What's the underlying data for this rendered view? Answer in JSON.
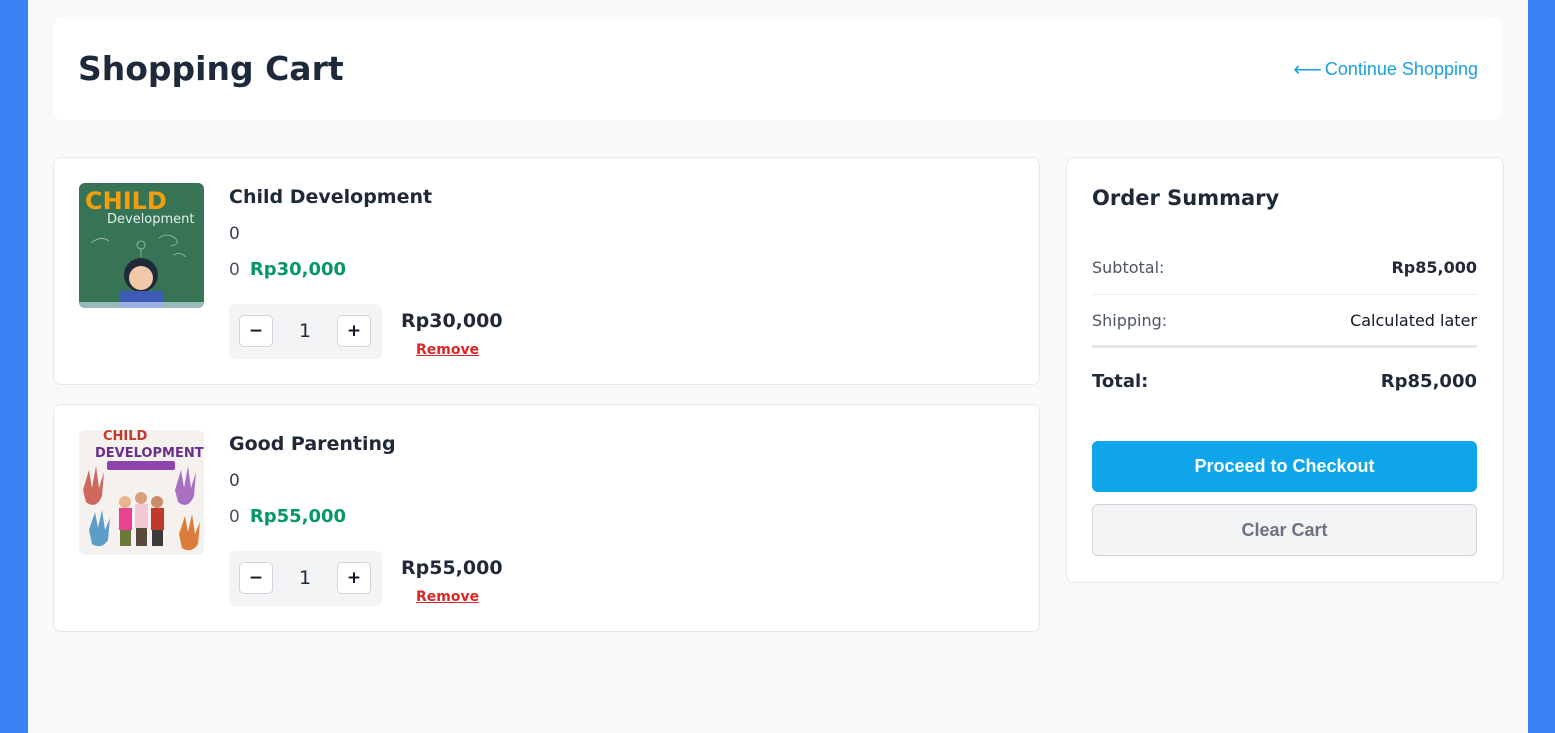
{
  "header": {
    "title": "Shopping Cart",
    "continue_arrow": "⟵",
    "continue_label": "Continue Shopping"
  },
  "cart": {
    "items": [
      {
        "title": "Child Development",
        "meta": "0",
        "price_prefix": "0",
        "price": "Rp30,000",
        "quantity": "1",
        "line_total": "Rp30,000",
        "remove_label": "Remove",
        "minus_label": "−",
        "plus_label": "+",
        "cover_text_1": "CHILD",
        "cover_text_2": "Development"
      },
      {
        "title": "Good Parenting",
        "meta": "0",
        "price_prefix": "0",
        "price": "Rp55,000",
        "quantity": "1",
        "line_total": "Rp55,000",
        "remove_label": "Remove",
        "minus_label": "−",
        "plus_label": "+",
        "cover_text_1": "CHILD",
        "cover_text_2": "DEVELOPMENT"
      }
    ]
  },
  "summary": {
    "title": "Order Summary",
    "subtotal_label": "Subtotal:",
    "subtotal_value": "Rp85,000",
    "shipping_label": "Shipping:",
    "shipping_value": "Calculated later",
    "total_label": "Total:",
    "total_value": "Rp85,000",
    "checkout_label": "Proceed to Checkout",
    "clear_label": "Clear Cart"
  },
  "colors": {
    "accent": "#0ea5e9",
    "link": "#1aa0e0",
    "price": "#059669",
    "remove": "#dc2626",
    "frame": "#3b82f6"
  }
}
